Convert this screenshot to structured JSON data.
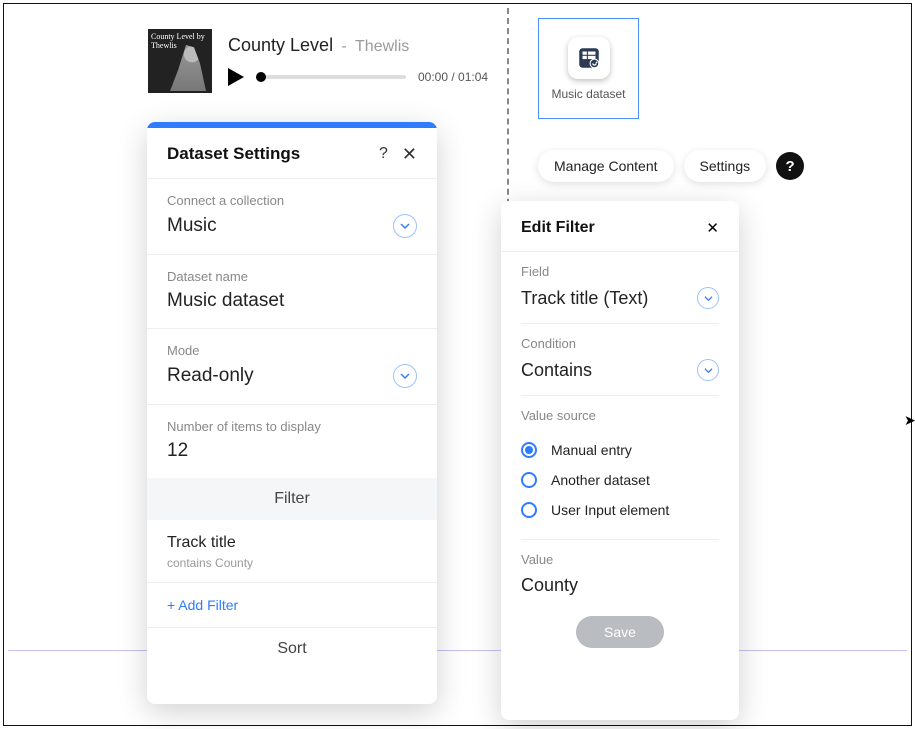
{
  "player": {
    "album_text": "County Level by Thewlis",
    "track_title": "County Level",
    "separator": "-",
    "artist": "Thewlis",
    "time": "00:00 / 01:04"
  },
  "selection": {
    "label": "Music dataset"
  },
  "toolbar": {
    "manage_content": "Manage Content",
    "settings": "Settings",
    "help": "?"
  },
  "dataset_panel": {
    "title": "Dataset Settings",
    "help": "?",
    "close": "✕",
    "connect_label": "Connect a collection",
    "connect_value": "Music",
    "name_label": "Dataset name",
    "name_value": "Music dataset",
    "mode_label": "Mode",
    "mode_value": "Read-only",
    "items_label": "Number of items to display",
    "items_value": "12",
    "filter_header": "Filter",
    "filter_item_title": "Track title",
    "filter_item_sub": "contains County",
    "add_filter": "+ Add Filter",
    "sort_header": "Sort"
  },
  "edit_filter": {
    "title": "Edit Filter",
    "close": "✕",
    "field_label": "Field",
    "field_value": "Track title (Text)",
    "condition_label": "Condition",
    "condition_value": "Contains",
    "source_label": "Value source",
    "sources": {
      "manual": "Manual entry",
      "another": "Another dataset",
      "userinput": "User Input element"
    },
    "value_label": "Value",
    "value": "County",
    "save": "Save"
  }
}
